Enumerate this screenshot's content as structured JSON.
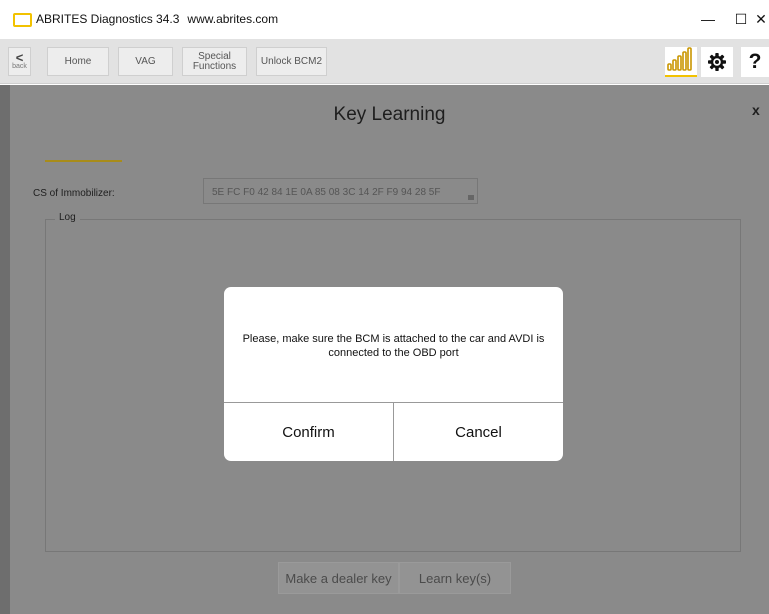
{
  "window": {
    "app_name": "ABRITES Diagnostics 34.3",
    "url": "www.abrites.com",
    "minimize_glyph": "—",
    "maximize_glyph": "☐",
    "close_glyph": "✕"
  },
  "navbar": {
    "back_chevron": "<",
    "back_label": "back",
    "items": [
      "Home",
      "VAG",
      "Special Functions",
      "Unlock BCM2"
    ],
    "help_label": "?"
  },
  "page": {
    "title": "Key Learning",
    "close_label": "x",
    "cs_label": "CS of Immobilizer:",
    "cs_value": "5E FC F0 42 84 1E 0A 85 08 3C 14 2F F9 94 28 5F",
    "log_label": "Log",
    "buttons": [
      "Make a dealer key",
      "Learn key(s)"
    ]
  },
  "dialog": {
    "message": "Please, make sure the BCM is attached to the car and AVDI is connected to the OBD port",
    "confirm_label": "Confirm",
    "cancel_label": "Cancel"
  },
  "colors": {
    "accent": "#f2c200",
    "overlay": "#8a8a8a"
  }
}
